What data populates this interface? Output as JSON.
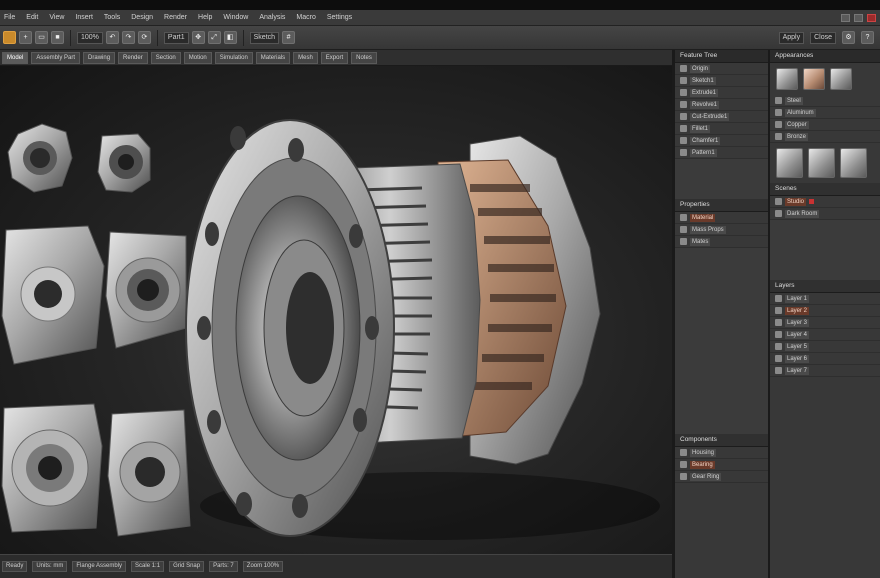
{
  "menubar": {
    "items": [
      "File",
      "Edit",
      "View",
      "Insert",
      "Tools",
      "Design",
      "Render",
      "Help",
      "Window",
      "Analysis",
      "Macro",
      "Settings"
    ]
  },
  "toolbar": {
    "left_fields": [
      "100%",
      "Part1",
      "Sketch"
    ],
    "right_buttons": [
      "Apply",
      "Close"
    ]
  },
  "tabs": [
    "Model",
    "Assembly Part",
    "Drawing",
    "Render",
    "Section",
    "Motion",
    "Simulation",
    "Materials",
    "Mesh",
    "Export",
    "Notes"
  ],
  "statusbar": [
    "Ready",
    "Units: mm",
    "Flange Assembly",
    "Scale 1:1",
    "Grid Snap",
    "Parts: 7",
    "Zoom 100%"
  ],
  "panel_a": {
    "header": "Feature Tree",
    "rows": [
      {
        "label": "Origin"
      },
      {
        "label": "Sketch1"
      },
      {
        "label": "Extrude1"
      },
      {
        "label": "Revolve1"
      },
      {
        "label": "Cut-Extrude1"
      },
      {
        "label": "Fillet1"
      },
      {
        "label": "Chamfer1"
      },
      {
        "label": "Pattern1"
      }
    ],
    "section2": "Properties",
    "rows2": [
      {
        "label": "Material"
      },
      {
        "label": "Mass Props"
      },
      {
        "label": "Mates"
      }
    ],
    "section3": "Components",
    "rows3": [
      {
        "label": "Housing"
      },
      {
        "label": "Bearing"
      },
      {
        "label": "Gear Ring"
      }
    ]
  },
  "panel_b": {
    "header": "Appearances",
    "rows": [
      {
        "label": "Steel"
      },
      {
        "label": "Aluminum"
      },
      {
        "label": "Copper"
      },
      {
        "label": "Bronze"
      }
    ],
    "section2": "Scenes",
    "rows2": [
      {
        "label": "Studio"
      },
      {
        "label": "Dark Room"
      }
    ],
    "section3": "Layers",
    "rows3": [
      {
        "label": "Layer 1"
      },
      {
        "label": "Layer 2"
      },
      {
        "label": "Layer 3"
      },
      {
        "label": "Layer 4"
      },
      {
        "label": "Layer 5"
      },
      {
        "label": "Layer 6"
      },
      {
        "label": "Layer 7"
      }
    ]
  }
}
